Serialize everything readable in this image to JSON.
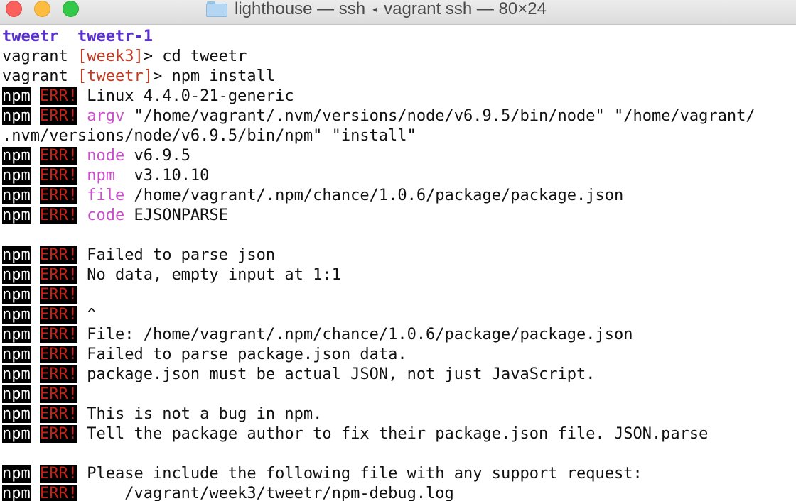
{
  "window": {
    "title_left": "lighthouse — ssh",
    "title_right": "vagrant ssh — 80×24",
    "separator_icon": "left-arrow-icon",
    "folder_icon": "folder-icon"
  },
  "colors": {
    "error_red": "#c4231a",
    "key_magenta": "#c94fcb",
    "dir_purple": "#5a2fd0",
    "branch_red": "#c23b22"
  },
  "terminal": {
    "lines": [
      {
        "segments": [
          {
            "t": "tweetr",
            "c": "dir"
          },
          {
            "t": "  "
          },
          {
            "t": "tweetr-1",
            "c": "dir"
          }
        ]
      },
      {
        "segments": [
          {
            "t": "vagrant "
          },
          {
            "t": "[",
            "c": "branch"
          },
          {
            "t": "week3",
            "c": "branch"
          },
          {
            "t": "]",
            "c": "branch"
          },
          {
            "t": "> cd tweetr"
          }
        ]
      },
      {
        "segments": [
          {
            "t": "vagrant "
          },
          {
            "t": "[",
            "c": "branch"
          },
          {
            "t": "tweetr",
            "c": "branch"
          },
          {
            "t": "]",
            "c": "branch"
          },
          {
            "t": "> npm install"
          }
        ]
      },
      {
        "prefix": true,
        "segments": [
          {
            "t": "Linux 4.4.0-21-generic"
          }
        ]
      },
      {
        "prefix": true,
        "segments": [
          {
            "t": "argv",
            "c": "key"
          },
          {
            "t": " \"/home/vagrant/.nvm/versions/node/v6.9.5/bin/node\" \"/home/vagrant/"
          }
        ]
      },
      {
        "segments": [
          {
            "t": ".nvm/versions/node/v6.9.5/bin/npm\" \"install\""
          }
        ]
      },
      {
        "prefix": true,
        "segments": [
          {
            "t": "node",
            "c": "key"
          },
          {
            "t": " v6.9.5"
          }
        ]
      },
      {
        "prefix": true,
        "segments": [
          {
            "t": "npm ",
            "c": "key"
          },
          {
            "t": " v3.10.10"
          }
        ]
      },
      {
        "prefix": true,
        "segments": [
          {
            "t": "file",
            "c": "key"
          },
          {
            "t": " /home/vagrant/.npm/chance/1.0.6/package/package.json"
          }
        ]
      },
      {
        "prefix": true,
        "segments": [
          {
            "t": "code",
            "c": "key"
          },
          {
            "t": " EJSONPARSE"
          }
        ]
      },
      {
        "segments": []
      },
      {
        "prefix": true,
        "segments": [
          {
            "t": "Failed to parse json"
          }
        ]
      },
      {
        "prefix": true,
        "segments": [
          {
            "t": "No data, empty input at 1:1"
          }
        ]
      },
      {
        "prefix": true,
        "segments": []
      },
      {
        "prefix": true,
        "segments": [
          {
            "t": "^"
          }
        ]
      },
      {
        "prefix": true,
        "segments": [
          {
            "t": "File: /home/vagrant/.npm/chance/1.0.6/package/package.json"
          }
        ]
      },
      {
        "prefix": true,
        "segments": [
          {
            "t": "Failed to parse package.json data."
          }
        ]
      },
      {
        "prefix": true,
        "segments": [
          {
            "t": "package.json must be actual JSON, not just JavaScript."
          }
        ]
      },
      {
        "prefix": true,
        "segments": []
      },
      {
        "prefix": true,
        "segments": [
          {
            "t": "This is not a bug in npm."
          }
        ]
      },
      {
        "prefix": true,
        "segments": [
          {
            "t": "Tell the package author to fix their package.json file. JSON.parse"
          }
        ]
      },
      {
        "segments": []
      },
      {
        "prefix": true,
        "segments": [
          {
            "t": "Please include the following file with any support request:"
          }
        ]
      },
      {
        "prefix": true,
        "segments": [
          {
            "t": "    /vagrant/week3/tweetr/npm-debug.log"
          }
        ]
      }
    ]
  }
}
